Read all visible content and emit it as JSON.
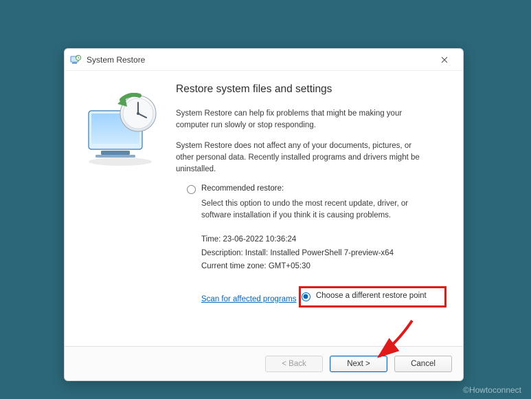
{
  "window": {
    "title": "System Restore"
  },
  "heading": "Restore system files and settings",
  "para1": "System Restore can help fix problems that might be making your computer run slowly or stop responding.",
  "para2": "System Restore does not affect any of your documents, pictures, or other personal data. Recently installed programs and drivers might be uninstalled.",
  "option1": {
    "label": "Recommended restore:",
    "desc": "Select this option to undo the most recent update, driver, or software installation if you think it is causing problems."
  },
  "info": {
    "time_label": "Time:",
    "time_value": "23-06-2022 10:36:24",
    "desc_label": "Description:",
    "desc_value": "Install: Installed PowerShell 7-preview-x64",
    "tz_label": "Current time zone:",
    "tz_value": "GMT+05:30"
  },
  "scan_link": "Scan for affected programs",
  "option2": {
    "label": "Choose a different restore point"
  },
  "buttons": {
    "back": "< Back",
    "next": "Next >",
    "cancel": "Cancel"
  },
  "watermark": "©Howtoconnect"
}
